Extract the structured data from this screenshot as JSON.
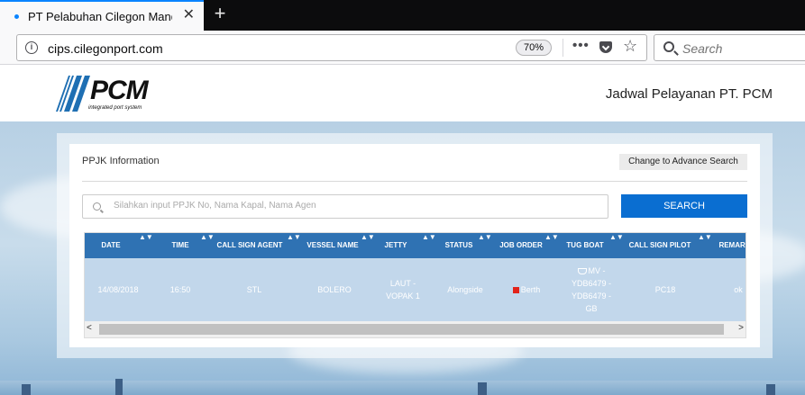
{
  "browser": {
    "tab_title": "PT Pelabuhan Cilegon Mandiri",
    "tab_close": "✕",
    "new_tab": "+",
    "url": "cips.cilegonport.com",
    "zoom": "70%",
    "page_actions": "•••",
    "bookmark_icon": "☆",
    "search_placeholder": "Search"
  },
  "header": {
    "logo_text": "PCM",
    "logo_sub": "integrated port system",
    "title": "Jadwal Pelayanan PT. PCM"
  },
  "panel": {
    "heading": "PPJK Information",
    "advance_button": "Change to Advance Search",
    "search_placeholder": "Silahkan input PPJK No, Nama Kapal, Nama Agen",
    "search_button": "SEARCH"
  },
  "table": {
    "columns": [
      "DATE",
      "TIME",
      "CALL SIGN AGENT",
      "VESSEL NAME",
      "JETTY",
      "STATUS",
      "JOB ORDER",
      "TUG BOAT",
      "CALL SIGN PILOT",
      "REMARK"
    ],
    "rows": [
      {
        "date": "14/08/2018",
        "time": "16:50",
        "call_sign_agent": "STL",
        "vessel_name": "BOLERO",
        "jetty": "LAUT - VOPAK 1",
        "status": "Alongside",
        "job_order": "Berth",
        "tug_boat": "MV - YDB6479 - YDB6479 - GB",
        "call_sign_pilot": "PC18",
        "remark": "ok"
      }
    ],
    "scroll_left": "<",
    "scroll_right": ">"
  },
  "icons": [
    "info-icon",
    "pocket-icon",
    "star-icon",
    "search-icon",
    "flag-icon",
    "ship-icon"
  ],
  "colors": {
    "accent": "#0a6ed1",
    "table_header": "#2f72b3",
    "row_bg": "#c2d7eb"
  }
}
